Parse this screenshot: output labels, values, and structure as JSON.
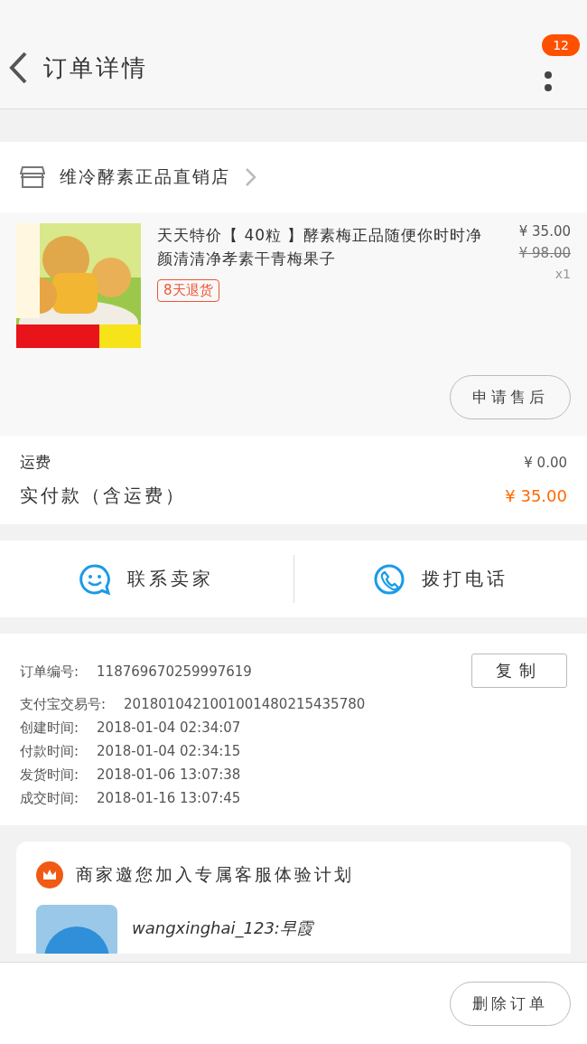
{
  "header": {
    "title": "订单详情",
    "badge": "12"
  },
  "store": {
    "name": "维冷酵素正品直销店"
  },
  "product": {
    "title": "天天特价【 40粒 】酵素梅正品随便你时时净颜清清净孝素干青梅果子",
    "tag": "8天退货",
    "price": "¥ 35.00",
    "original_price": "¥ 98.00",
    "quantity": "x1",
    "action": "申请售后"
  },
  "fees": [
    {
      "label": "运费",
      "value": "¥ 0.00",
      "kind": "plain"
    },
    {
      "label": "实付款（含运费）",
      "value": "¥ 35.00",
      "kind": "total"
    }
  ],
  "contact": [
    {
      "label": "联系卖家",
      "kind": "chat"
    },
    {
      "label": "拨打电话",
      "kind": "phone"
    }
  ],
  "order_info": {
    "copy_button": "复制",
    "rows": [
      {
        "label": "订单编号:",
        "value": "118769670259997619"
      },
      {
        "label": "支付宝交易号:",
        "value": "2018010421001001480215435780"
      },
      {
        "label": "创建时间:",
        "value": "2018-01-04 02:34:07"
      },
      {
        "label": "付款时间:",
        "value": "2018-01-04 02:34:15"
      },
      {
        "label": "发货时间:",
        "value": "2018-01-06 13:07:38"
      },
      {
        "label": "成交时间:",
        "value": "2018-01-16 13:07:45"
      }
    ]
  },
  "promo": {
    "title": "商家邀您加入专属客服体验计划",
    "account": "wangxinghai_123:早霞"
  },
  "bottom_bar": {
    "button": "删除订单"
  }
}
